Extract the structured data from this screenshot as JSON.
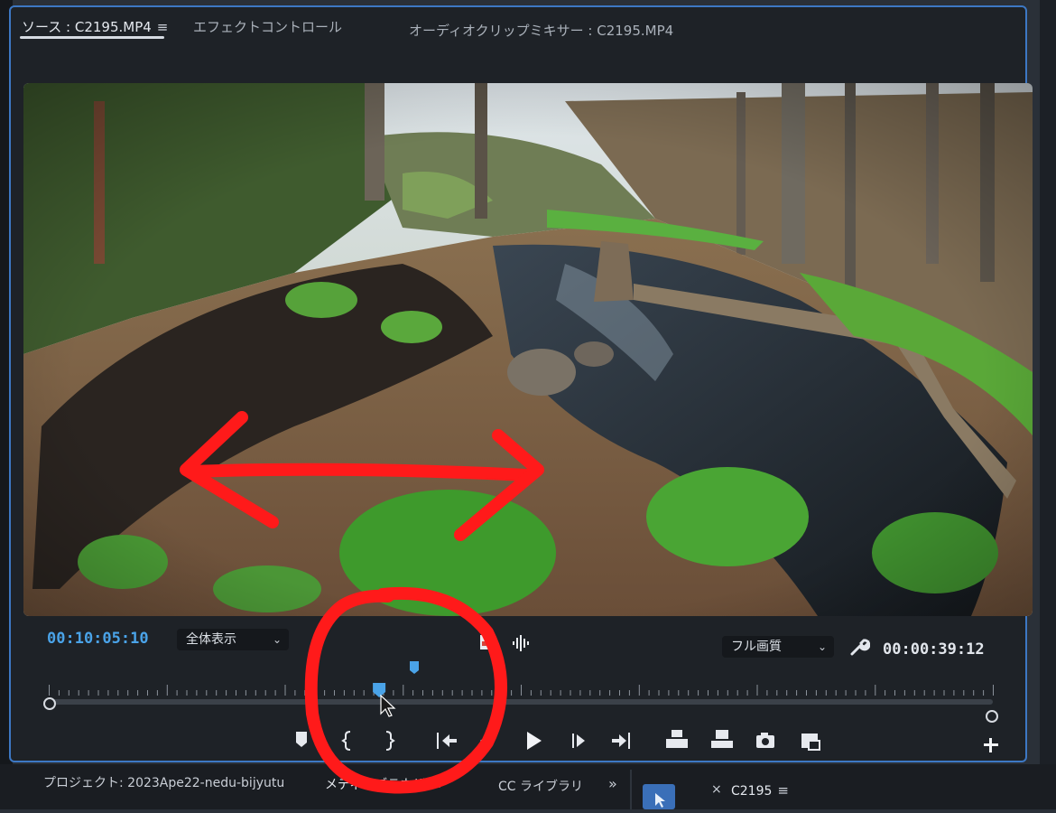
{
  "tabs": [
    {
      "label": "ソース : C2195.MP4",
      "active": true
    },
    {
      "label": "エフェクトコントロール",
      "active": false
    },
    {
      "label": "オーディオクリップミキサー : C2195.MP4",
      "active": false
    }
  ],
  "tab_menu_glyph": "≡",
  "source_timecode": "00:10:05:10",
  "zoom_dropdown": {
    "value": "全体表示"
  },
  "quality_dropdown": {
    "value": "フル画質"
  },
  "duration_timecode": "00:00:39:12",
  "playhead_fraction": 0.35,
  "bottom_bar": {
    "project_label": "プロジェクト: 2023Ape22-nedu-bijyutu",
    "media_tab": "メディアブラウザ",
    "cc_tab": "CC ライブラリ",
    "more": "»",
    "sequence_close": "×",
    "sequence_name": "C2195",
    "sequence_menu": "≡"
  },
  "transport_icons": [
    "add-marker-icon",
    "mark-in-icon",
    "mark-out-icon",
    "go-to-in-icon",
    "step-back-icon",
    "play-icon",
    "step-forward-icon",
    "go-to-out-icon",
    "insert-icon",
    "overwrite-icon",
    "export-frame-icon",
    "button-editor-icon",
    "add-button-icon"
  ],
  "colors": {
    "accent": "#4aa3e8",
    "annotation": "#ff1a1a",
    "panel_border": "#3d78c4"
  }
}
